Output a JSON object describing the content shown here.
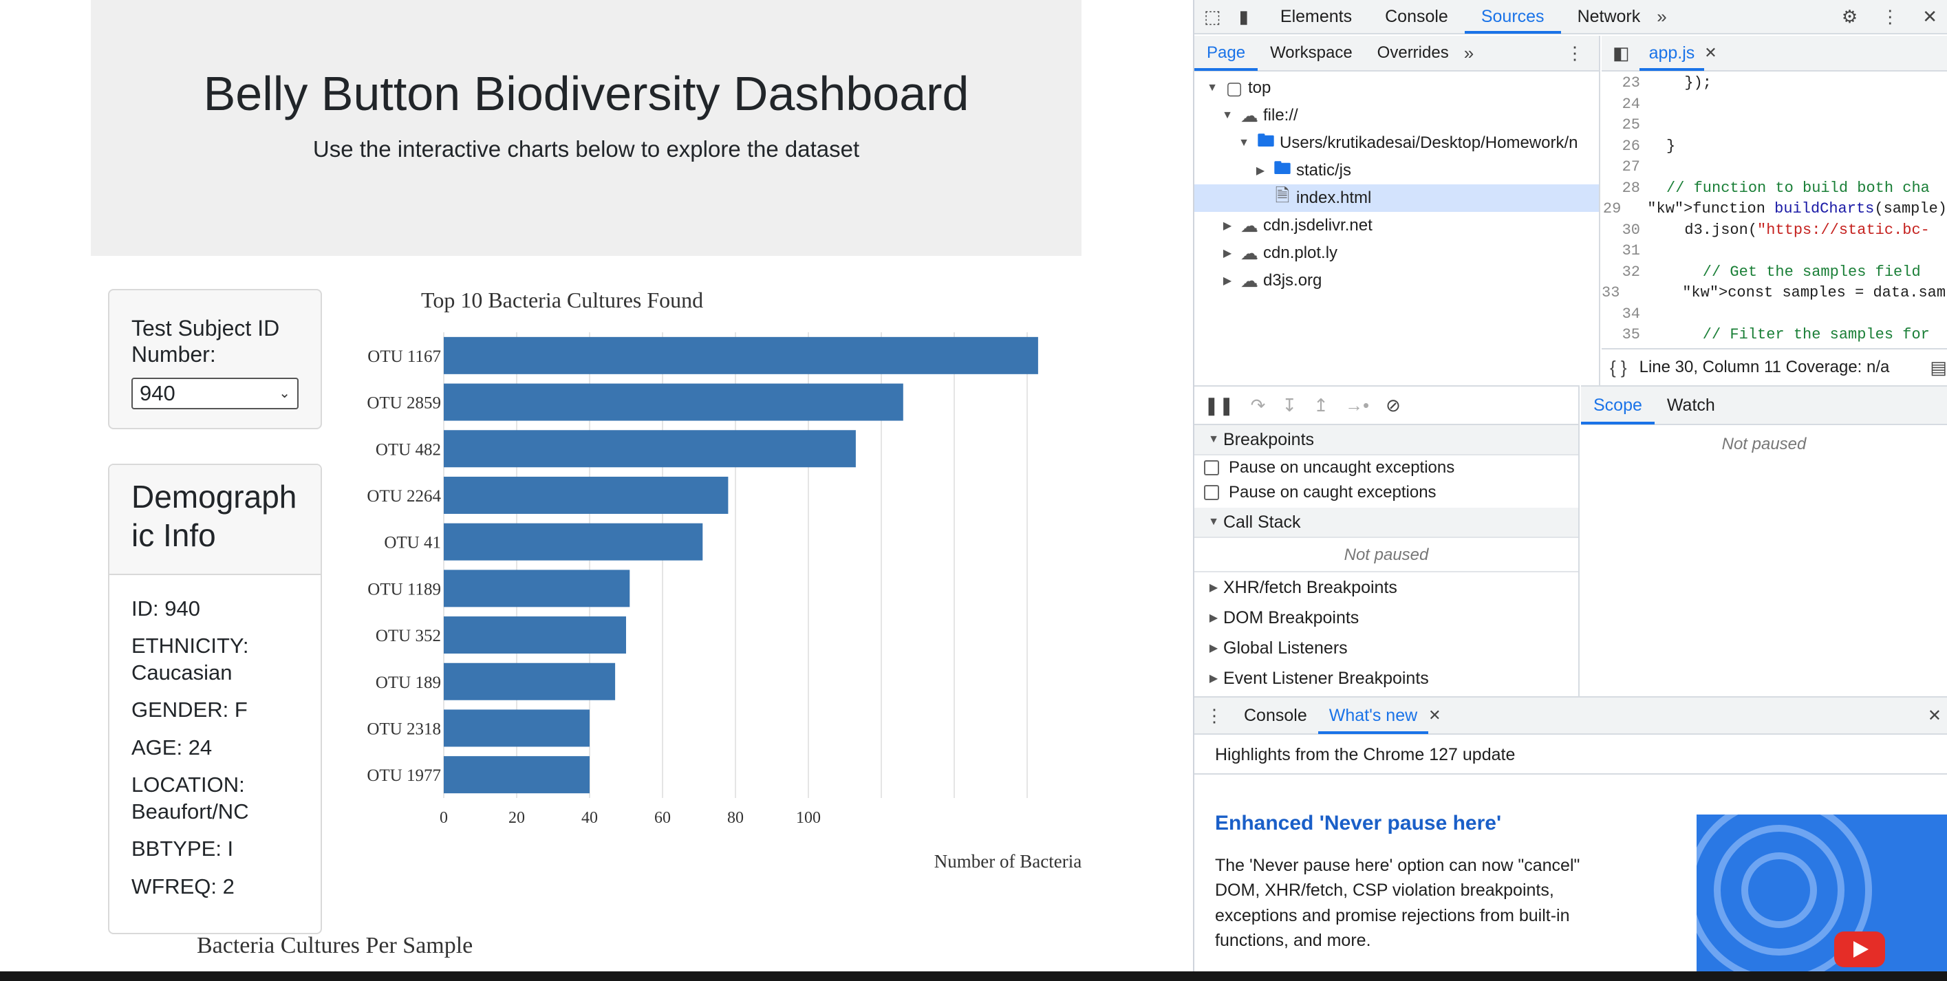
{
  "page": {
    "title": "Belly Button Biodiversity Dashboard",
    "subtitle": "Use the interactive charts below to explore the dataset",
    "select_label": "Test Subject ID Number:",
    "selected_id": "940",
    "demo_title": "Demographic Info",
    "demographics": [
      "ID: 940",
      "ETHNICITY: Caucasian",
      "GENDER: F",
      "AGE: 24",
      "LOCATION: Beaufort/NC",
      "BBTYPE: I",
      "WFREQ: 2"
    ],
    "bubble_title": "Bacteria Cultures Per Sample"
  },
  "chart_data": {
    "type": "bar",
    "orientation": "horizontal",
    "title": "Top 10 Bacteria Cultures Found",
    "xlabel": "Number of Bacteria",
    "ylabel": "",
    "categories": [
      "OTU 1167",
      "OTU 2859",
      "OTU 482",
      "OTU 2264",
      "OTU 41",
      "OTU 1189",
      "OTU 352",
      "OTU 189",
      "OTU 2318",
      "OTU 1977"
    ],
    "values": [
      163,
      126,
      113,
      78,
      71,
      51,
      50,
      47,
      40,
      40
    ],
    "xticks": [
      0,
      20,
      40,
      60,
      80,
      100
    ],
    "xlim": [
      0,
      175
    ],
    "bar_color": "#3a75b0",
    "grid": true
  },
  "devtools": {
    "top_tabs": [
      "Elements",
      "Console",
      "Sources",
      "Network"
    ],
    "active_top_tab": "Sources",
    "nav_tabs": [
      "Page",
      "Workspace",
      "Overrides"
    ],
    "tree": {
      "top": "top",
      "file": "file://",
      "path": "Users/krutikadesai/Desktop/Homework/n",
      "static": "static/js",
      "index": "index.html",
      "cdn1": "cdn.jsdelivr.net",
      "cdn2": "cdn.plot.ly",
      "cdn3": "d3js.org"
    },
    "editor_tab": "app.js",
    "code_lines": [
      {
        "n": "23",
        "t": "  });"
      },
      {
        "n": "24",
        "t": ""
      },
      {
        "n": "25",
        "t": ""
      },
      {
        "n": "26",
        "t": "}"
      },
      {
        "n": "27",
        "t": ""
      },
      {
        "n": "28",
        "t": "// function to build both cha"
      },
      {
        "n": "29",
        "t": "function buildCharts(sample)"
      },
      {
        "n": "30",
        "t": "  d3.json(\"https://static.bc-"
      },
      {
        "n": "31",
        "t": ""
      },
      {
        "n": "32",
        "t": "    // Get the samples field"
      },
      {
        "n": "33",
        "t": "    const samples = data.samp"
      },
      {
        "n": "34",
        "t": ""
      },
      {
        "n": "35",
        "t": "    // Filter the samples for"
      }
    ],
    "status_text": "Line 30, Column 11 Coverage: n/a",
    "breakpoints_title": "Breakpoints",
    "pause_uncaught": "Pause on uncaught exceptions",
    "pause_caught": "Pause on caught exceptions",
    "call_stack_title": "Call Stack",
    "not_paused": "Not paused",
    "collapsed_sections": [
      "XHR/fetch Breakpoints",
      "DOM Breakpoints",
      "Global Listeners",
      "Event Listener Breakpoints"
    ],
    "scope_tab": "Scope",
    "watch_tab": "Watch",
    "scope_not_paused": "Not paused",
    "drawer_tabs": [
      "Console",
      "What's new"
    ],
    "highlights": "Highlights from the Chrome 127 update",
    "feature_title": "Enhanced 'Never pause here'",
    "feature_text": "The 'Never pause here' option can now \"cancel\" DOM, XHR/fetch, CSP violation breakpoints, exceptions and promise rejections from built-in functions, and more."
  }
}
